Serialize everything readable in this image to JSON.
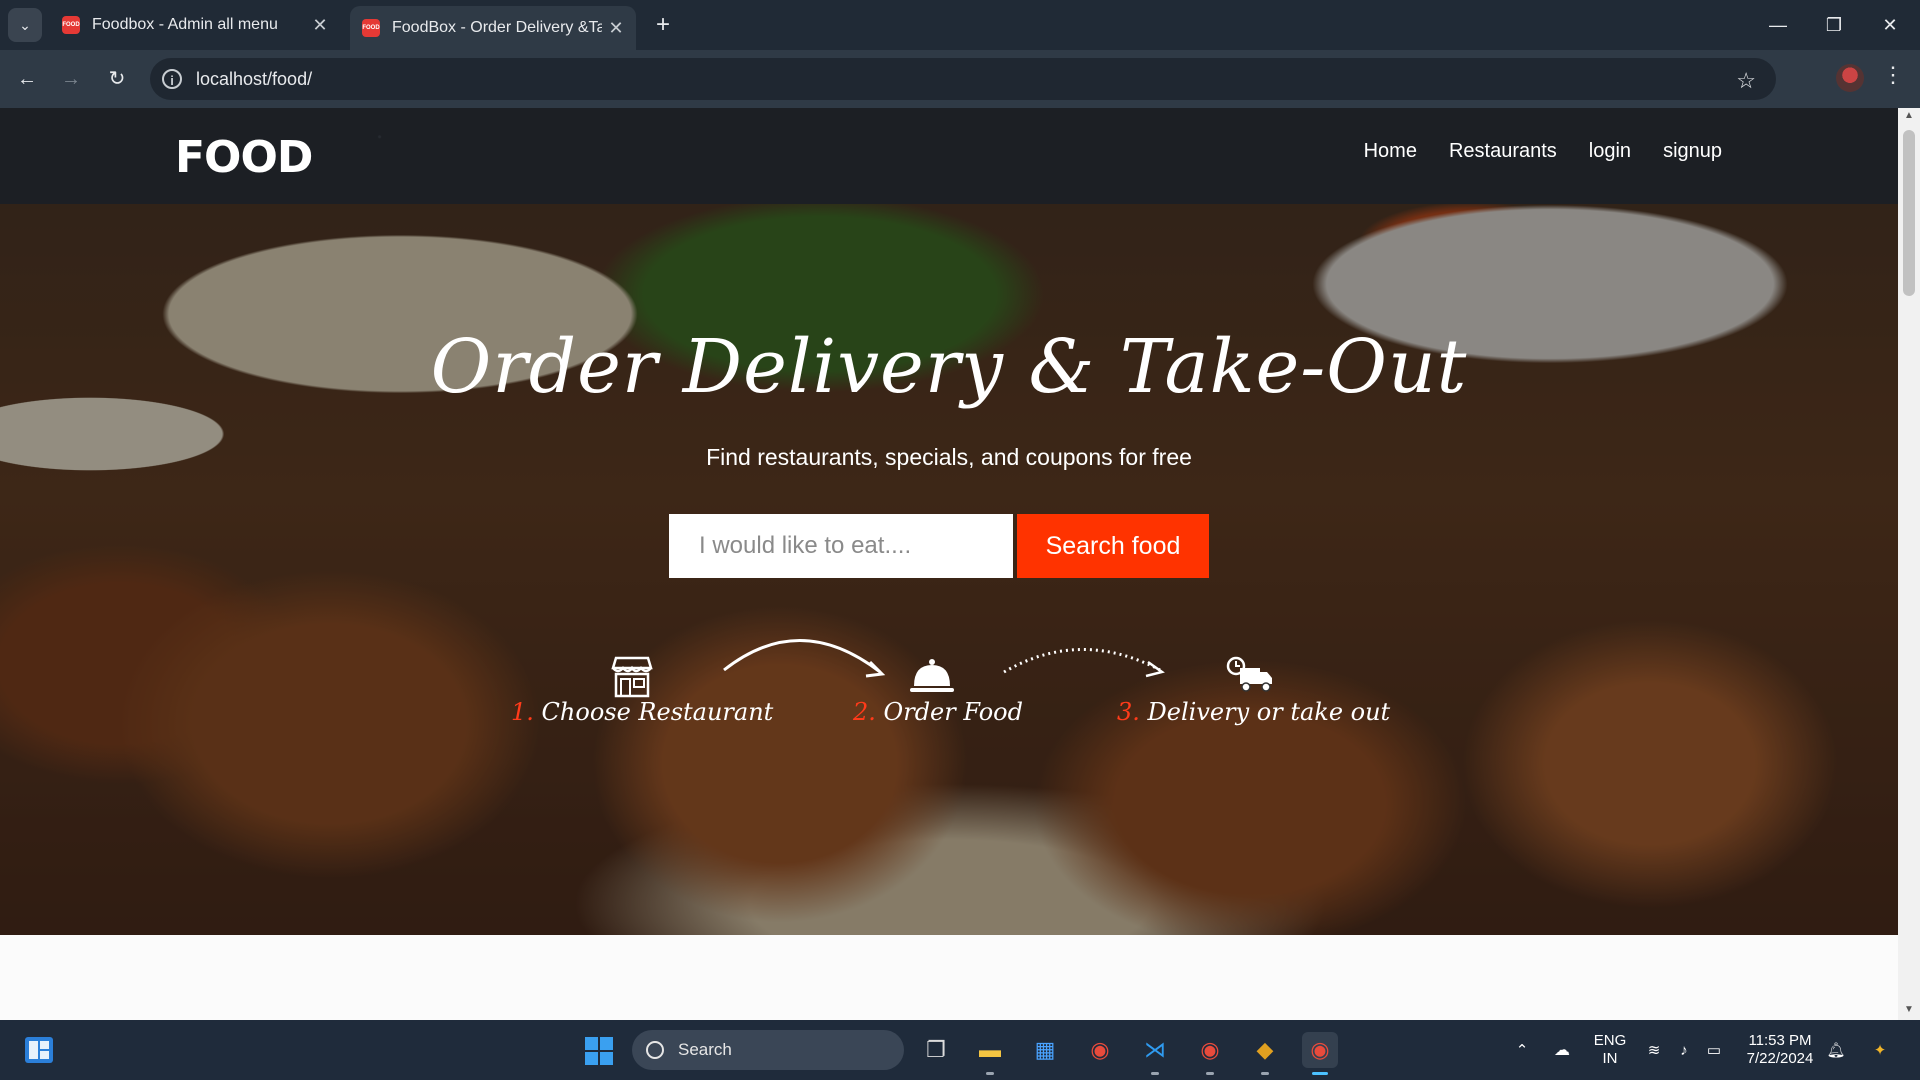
{
  "browser": {
    "tabs": [
      {
        "title": "Foodbox - Admin all menu",
        "favicon": "FOOD"
      },
      {
        "title": "FoodBox - Order Delivery &Take-Out",
        "favicon": "FOOD"
      }
    ],
    "url": "localhost/food/"
  },
  "site": {
    "logo": "FOOD",
    "nav": [
      "Home",
      "Restaurants",
      "login",
      "signup"
    ]
  },
  "hero": {
    "title": "Order Delivery & Take-Out",
    "subtitle": "Find restaurants, specials, and coupons for free",
    "search_placeholder": "I would like to eat....",
    "search_button": "Search food",
    "steps": [
      {
        "num": "1.",
        "label": "Choose Restaurant",
        "icon": "storefront-icon"
      },
      {
        "num": "2.",
        "label": "Order Food",
        "icon": "food-cloche-icon"
      },
      {
        "num": "3.",
        "label": "Delivery or take out",
        "icon": "delivery-truck-icon"
      }
    ]
  },
  "taskbar": {
    "search_label": "Search",
    "lang_top": "ENG",
    "lang_bottom": "IN",
    "time": "11:53 PM",
    "date": "7/22/2024"
  },
  "colors": {
    "accent": "#ff3300",
    "nav_bg": "#1c1f24",
    "chrome_bg": "#202a36"
  }
}
